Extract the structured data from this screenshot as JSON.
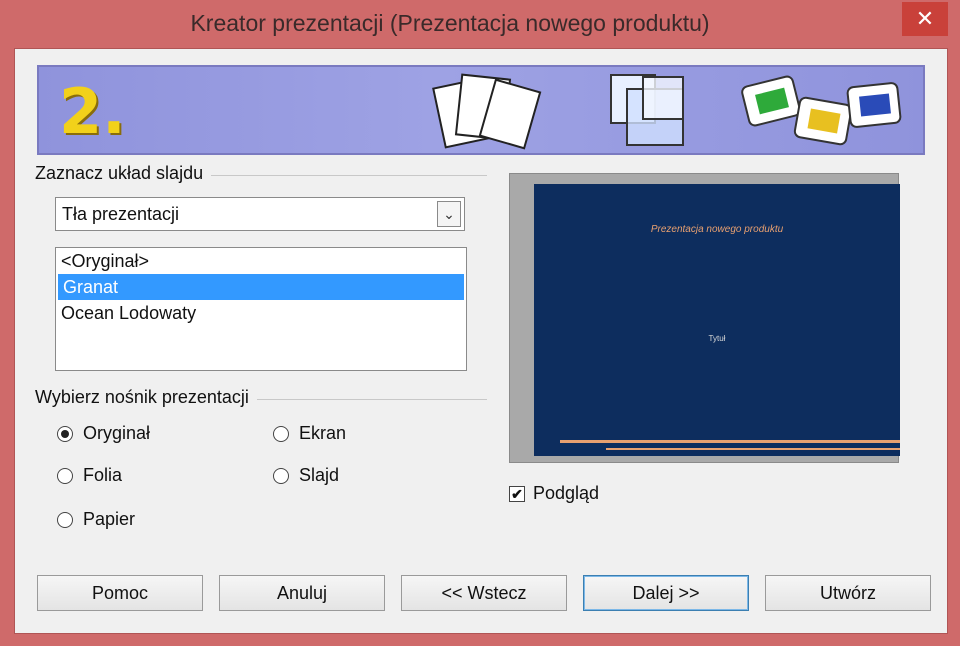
{
  "window": {
    "title": "Kreator prezentacji (Prezentacja nowego produktu)",
    "close_glyph": "✕"
  },
  "banner": {
    "step": "2.",
    "icons": [
      "pages-icon",
      "transparency-icon",
      "slides-icon"
    ]
  },
  "layout_group": {
    "label": "Zaznacz układ slajdu",
    "dropdown": {
      "value": "Tła prezentacji",
      "arrow": "⌄"
    },
    "list": {
      "items": [
        "<Oryginał>",
        "Granat",
        "Ocean Lodowaty"
      ],
      "selected_index": 1
    }
  },
  "medium_group": {
    "label": "Wybierz nośnik prezentacji",
    "options": [
      "Oryginał",
      "Folia",
      "Papier",
      "Ekran",
      "Slajd"
    ],
    "selected": "Oryginał"
  },
  "preview": {
    "slide_title": "Prezentacja nowego produktu",
    "slide_subtitle": "Tytuł",
    "colors": {
      "background": "#0d2d5e",
      "accent": "#e8a070"
    },
    "checkbox_label": "Podgląd",
    "checkbox_checked": true,
    "check_glyph": "✔"
  },
  "buttons": {
    "help": "Pomoc",
    "cancel": "Anuluj",
    "back": "<< Wstecz",
    "next": "Dalej >>",
    "create": "Utwórz"
  },
  "colors": {
    "selection": "#3399ff",
    "title_bar": "#cf6a6a",
    "close_button": "#c9413a"
  }
}
